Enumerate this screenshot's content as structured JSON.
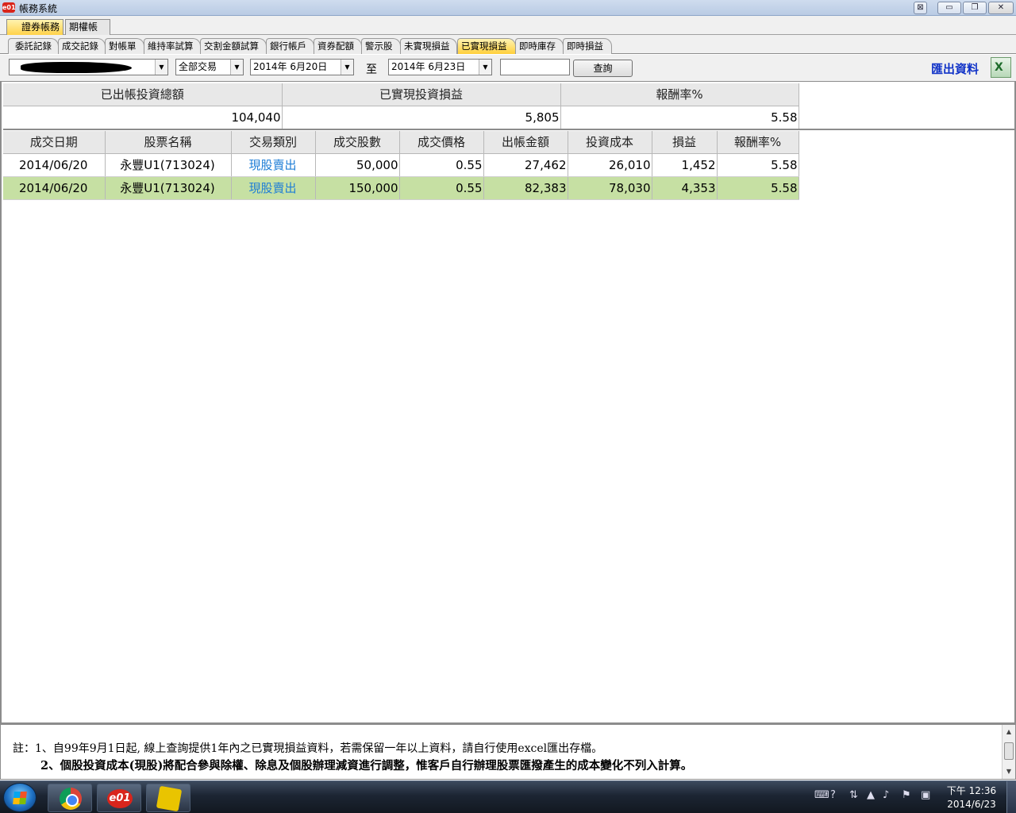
{
  "window": {
    "title": "帳務系統",
    "icon_label": "e01"
  },
  "top_tabs": [
    {
      "label": "證券帳務",
      "active": true
    },
    {
      "label": "期權帳務",
      "active": false
    }
  ],
  "sub_tabs": [
    {
      "label": "委託記錄",
      "active": false
    },
    {
      "label": "成交記錄",
      "active": false
    },
    {
      "label": "對帳單",
      "active": false
    },
    {
      "label": "維持率試算",
      "active": false
    },
    {
      "label": "交割金額試算",
      "active": false
    },
    {
      "label": "銀行帳戶",
      "active": false
    },
    {
      "label": "資券配額",
      "active": false
    },
    {
      "label": "警示股",
      "active": false
    },
    {
      "label": "未實現損益",
      "active": false
    },
    {
      "label": "已實現損益",
      "active": true
    },
    {
      "label": "即時庫存",
      "active": false
    },
    {
      "label": "即時損益",
      "active": false
    }
  ],
  "filters": {
    "trade_type": "全部交易",
    "date_from": "2014年  6月20日",
    "to_label": "至",
    "date_to": "2014年  6月23日",
    "extra_input": "",
    "query_label": "查詢",
    "export_label": "匯出資料"
  },
  "summary": {
    "headers": [
      "已出帳投資總額",
      "已實現投資損益",
      "報酬率%"
    ],
    "values": [
      "104,040",
      "5,805",
      "5.58"
    ]
  },
  "table": {
    "headers": [
      "成交日期",
      "股票名稱",
      "交易類別",
      "成交股數",
      "成交價格",
      "出帳金額",
      "投資成本",
      "損益",
      "報酬率%"
    ],
    "rows": [
      [
        "2014/06/20",
        "永豐U1(713024)",
        "現股賣出",
        "50,000",
        "0.55",
        "27,462",
        "26,010",
        "1,452",
        "5.58"
      ],
      [
        "2014/06/20",
        "永豐U1(713024)",
        "現股賣出",
        "150,000",
        "0.55",
        "82,383",
        "78,030",
        "4,353",
        "5.58"
      ]
    ]
  },
  "notes": {
    "line1": "註：1、自99年9月1日起, 線上查詢提供1年內之已實現損益資料，若需保留一年以上資料，請自行使用excel匯出存檔。",
    "line2": "2、個股投資成本(現股)將配合參與除權、除息及個股辦理減資進行調整，惟客戶自行辦理股票匯撥產生的成本變化不列入計算。"
  },
  "taskbar": {
    "clock_period_time": "下午 12:36",
    "clock_date": "2014/6/23"
  },
  "colors": {
    "active_tab": "#ffcf3b",
    "alt_row": "#c6e0a3",
    "link_text": "#1f7ed6",
    "export_text": "#1234c8"
  }
}
